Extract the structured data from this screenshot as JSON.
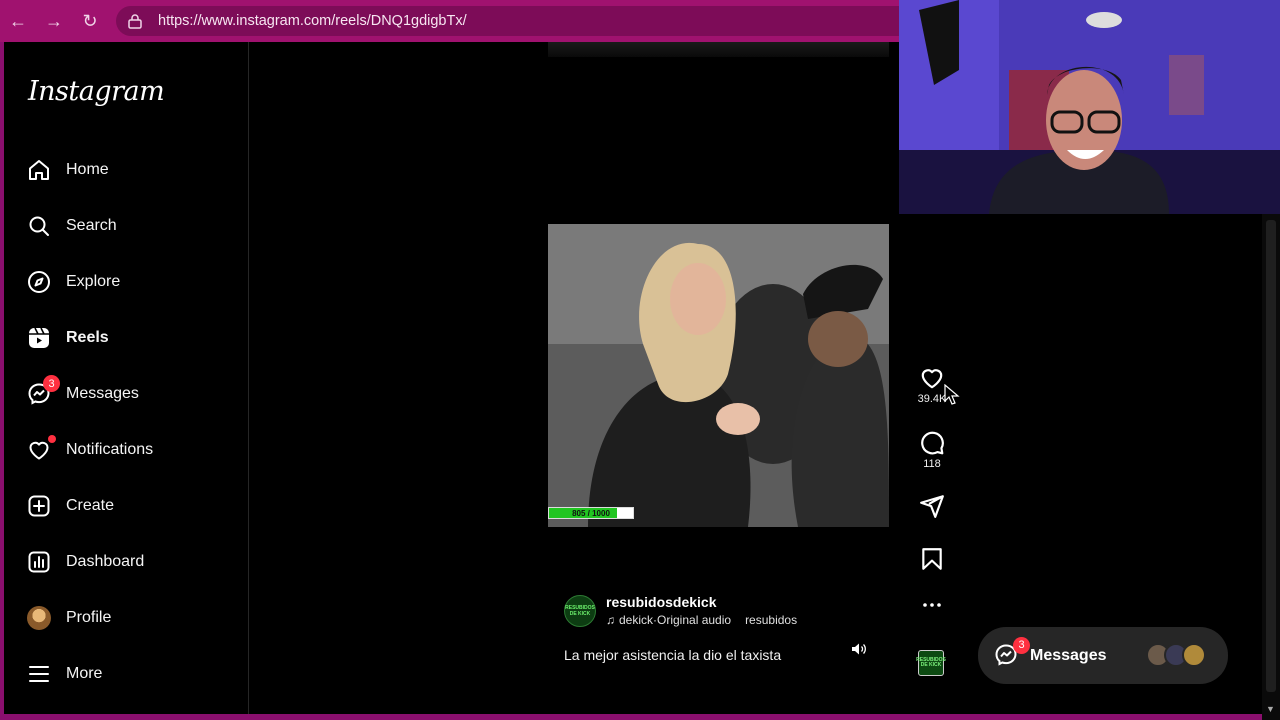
{
  "browser": {
    "url": "https://www.instagram.com/reels/DNQ1gdigbTx/"
  },
  "sidebar": {
    "logo": "Instagram",
    "items": [
      {
        "label": "Home",
        "icon": "home-icon"
      },
      {
        "label": "Search",
        "icon": "search-icon"
      },
      {
        "label": "Explore",
        "icon": "compass-icon"
      },
      {
        "label": "Reels",
        "icon": "reels-icon",
        "active": true
      },
      {
        "label": "Messages",
        "icon": "messenger-icon",
        "badge": "3"
      },
      {
        "label": "Notifications",
        "icon": "heart-icon",
        "dot": true
      },
      {
        "label": "Create",
        "icon": "plus-square-icon"
      },
      {
        "label": "Dashboard",
        "icon": "chart-icon"
      },
      {
        "label": "Profile",
        "icon": "avatar"
      },
      {
        "label": "More",
        "icon": "menu-icon"
      }
    ]
  },
  "reel": {
    "progress_text": "805 / 1000",
    "progress_fraction": 0.805,
    "author": "resubidosdekick",
    "author_pic_text": "RESUBIDOS DE KICK",
    "audio_artist": "dekick",
    "audio_label": "Original audio",
    "audio_separator": " · ",
    "audio_tag": "resubidos",
    "caption": "La mejor asistencia la dio el taxista",
    "likes": "39.4K",
    "comments": "118",
    "thumb_text": "RESUBIDOS DE KICK"
  },
  "messages_pill": {
    "label": "Messages",
    "badge": "3"
  },
  "colors": {
    "accent_red": "#ff3040",
    "browser_frame": "#a0126f"
  }
}
